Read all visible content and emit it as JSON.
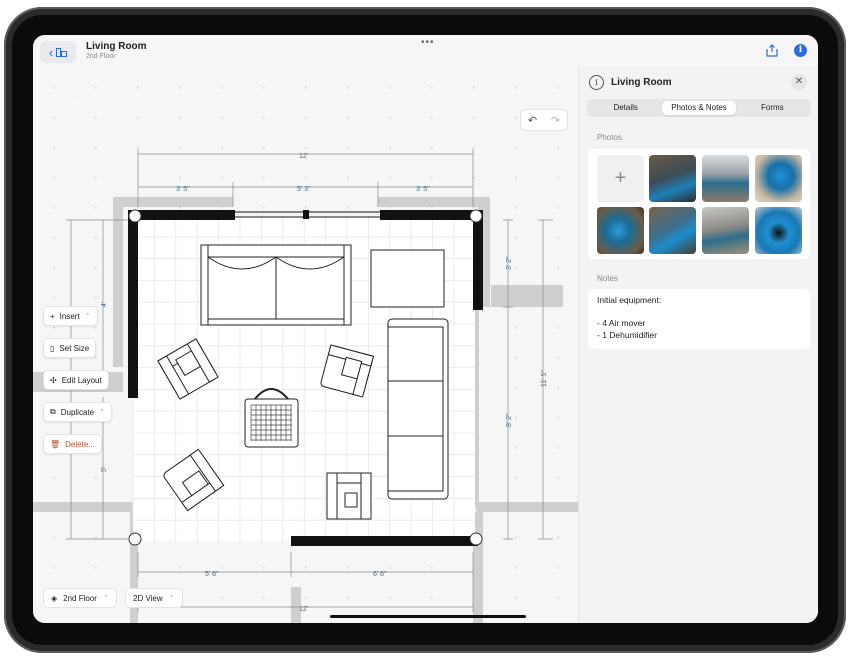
{
  "header": {
    "title": "Living Room",
    "subtitle": "2nd Floor",
    "more_glyph": "•••",
    "back_icon": "chevron-left-icon",
    "layout_icon": "floorplan-icon",
    "share_icon": "share-icon",
    "info_icon": "info-icon"
  },
  "history": {
    "undo": "↶",
    "redo": "↷"
  },
  "tools": {
    "insert": "Insert",
    "set_size": "Set Size",
    "edit_layout": "Edit Layout",
    "duplicate": "Duplicate",
    "delete": "Delete..."
  },
  "bottom": {
    "floor": "2nd Floor",
    "view": "2D View"
  },
  "dimensions": {
    "top_total": "12'",
    "top_left": "3' 5\"",
    "top_mid": "5' 3\"",
    "top_right": "3' 5\"",
    "right_upper": "3' 2\"",
    "right_total": "11' 5\"",
    "right_lower": "8' 2\"",
    "left_upper": "4'",
    "left_lower": "5'",
    "bottom_left": "5' 6\"",
    "bottom_right": "6' 6\"",
    "bottom_total": "12'"
  },
  "panel": {
    "title": "Living Room",
    "tabs": [
      {
        "label": "Details",
        "active": false
      },
      {
        "label": "Photos & Notes",
        "active": true
      },
      {
        "label": "Forms",
        "active": false
      }
    ],
    "photos_label": "Photos",
    "add_glyph": "+",
    "notes_label": "Notes",
    "notes_lines": [
      "Initial equipment:",
      "",
      "- 4 Air mover",
      "- 1 Dehumidifier"
    ]
  },
  "colors": {
    "accent": "#2d6cdf",
    "equipment_blue": "#1f8fd0",
    "wall": "#111111"
  }
}
